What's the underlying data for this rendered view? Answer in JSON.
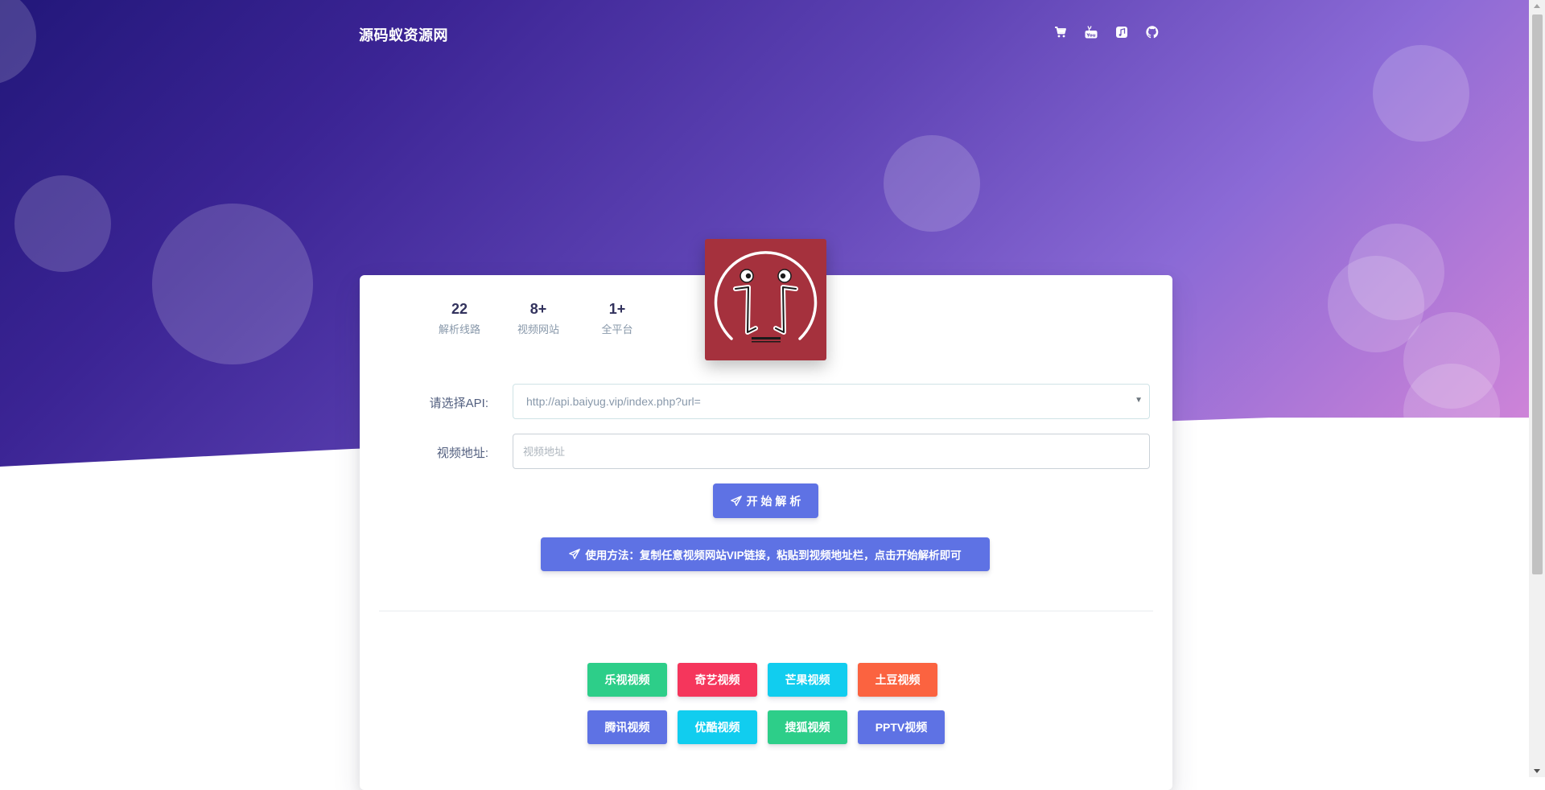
{
  "header": {
    "brand": "源码蚁资源网",
    "icons": [
      "shopping-cart-icon",
      "youtube-icon",
      "music-icon",
      "github-icon"
    ]
  },
  "stats": [
    {
      "value": "22",
      "label": "解析线路"
    },
    {
      "value": "8+",
      "label": "视频网站"
    },
    {
      "value": "1+",
      "label": "全平台"
    }
  ],
  "form": {
    "api_label": "请选择API:",
    "api_selected": "http://api.baiyug.vip/index.php?url=",
    "video_label": "视频地址:",
    "video_placeholder": "视频地址",
    "submit_label": "开 始 解 析",
    "usage_text": "使用方法：复制任意视频网站VIP链接，粘贴到视频地址栏，点击开始解析即可"
  },
  "sites": [
    {
      "label": "乐视视频",
      "color": "#2dce89"
    },
    {
      "label": "奇艺视频",
      "color": "#f5365c"
    },
    {
      "label": "芒果视频",
      "color": "#11cdef"
    },
    {
      "label": "土豆视频",
      "color": "#fb6340"
    },
    {
      "label": "腾讯视频",
      "color": "#5e72e4"
    },
    {
      "label": "优酷视频",
      "color": "#11cdef"
    },
    {
      "label": "搜狐视频",
      "color": "#2dce89"
    },
    {
      "label": "PPTV视频",
      "color": "#5e72e4"
    }
  ]
}
